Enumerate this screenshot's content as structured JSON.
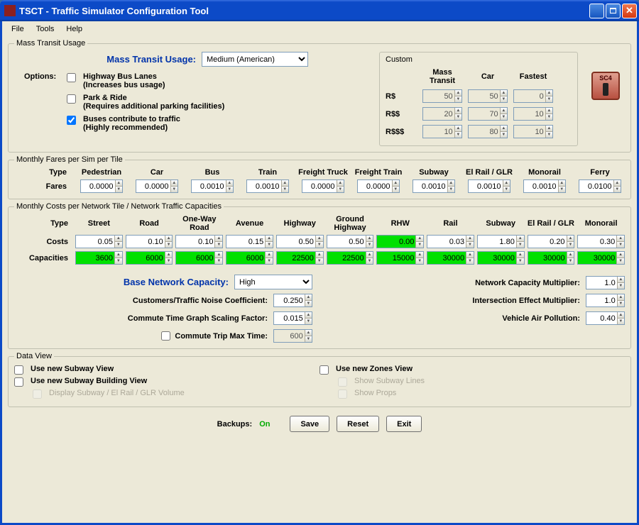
{
  "window": {
    "title": "TSCT - Traffic Simulator Configuration Tool"
  },
  "menubar": [
    "File",
    "Tools",
    "Help"
  ],
  "groups": {
    "mtu": "Mass Transit Usage",
    "fares": "Monthly Fares per Sim per Tile",
    "costs": "Monthly Costs per Network Tile / Network Traffic Capacities",
    "dataview": "Data View",
    "custom": "Custom"
  },
  "mtu": {
    "label": "Mass Transit Usage:",
    "select_value": "Medium (American)",
    "options_label": "Options:",
    "opt1": {
      "label": "Highway Bus Lanes",
      "sub": "(Increases bus usage)",
      "checked": false
    },
    "opt2": {
      "label": "Park & Ride",
      "sub": "(Requires additional parking facilities)",
      "checked": false
    },
    "opt3": {
      "label": "Buses contribute to traffic",
      "sub": "(Highly recommended)",
      "checked": true
    }
  },
  "custom": {
    "headers": [
      "Mass Transit",
      "Car",
      "Fastest"
    ],
    "rows": [
      {
        "label": "R$",
        "vals": [
          "50",
          "50",
          "0"
        ]
      },
      {
        "label": "R$$",
        "vals": [
          "20",
          "70",
          "10"
        ]
      },
      {
        "label": "R$$$",
        "vals": [
          "10",
          "80",
          "10"
        ]
      }
    ]
  },
  "fares": {
    "type_label": "Type",
    "headers": [
      "Pedestrian",
      "Car",
      "Bus",
      "Train",
      "Freight Truck",
      "Freight Train",
      "Subway",
      "El Rail / GLR",
      "Monorail",
      "Ferry"
    ],
    "row_label": "Fares",
    "values": [
      "0.0000",
      "0.0000",
      "0.0010",
      "0.0010",
      "0.0000",
      "0.0000",
      "0.0010",
      "0.0010",
      "0.0010",
      "0.0100"
    ]
  },
  "capacities": {
    "type_label": "Type",
    "headers": [
      "Street",
      "Road",
      "One-Way Road",
      "Avenue",
      "Highway",
      "Ground Highway",
      "RHW",
      "Rail",
      "Subway",
      "El Rail / GLR",
      "Monorail"
    ],
    "costs_label": "Costs",
    "costs": [
      "0.05",
      "0.10",
      "0.10",
      "0.15",
      "0.50",
      "0.50",
      "0.00",
      "0.03",
      "1.80",
      "0.20",
      "0.30"
    ],
    "cap_label": "Capacities",
    "caps": [
      "3600",
      "6000",
      "6000",
      "6000",
      "22500",
      "22500",
      "15000",
      "30000",
      "30000",
      "30000",
      "30000"
    ]
  },
  "params": {
    "base_capacity_label": "Base Network Capacity:",
    "base_capacity_value": "High",
    "noise_label": "Customers/Traffic Noise Coefficient:",
    "noise_value": "0.250",
    "commute_scale_label": "Commute Time Graph Scaling Factor:",
    "commute_scale_value": "0.015",
    "commute_max_label": "Commute Trip Max Time:",
    "commute_max_value": "600",
    "netcap_mult_label": "Network Capacity Multiplier:",
    "netcap_mult_value": "1.0",
    "intersection_label": "Intersection Effect Multiplier:",
    "intersection_value": "1.0",
    "air_label": "Vehicle Air Pollution:",
    "air_value": "0.40"
  },
  "dataview": {
    "subway_view": "Use new Subway View",
    "subway_building": "Use new Subway Building View",
    "display_volume": "Display Subway / El Rail / GLR Volume",
    "zones_view": "Use new Zones View",
    "show_lines": "Show Subway Lines",
    "show_props": "Show Props"
  },
  "footer": {
    "backups_label": "Backups:",
    "backups_value": "On",
    "save": "Save",
    "reset": "Reset",
    "exit": "Exit"
  },
  "logo": "SC4"
}
